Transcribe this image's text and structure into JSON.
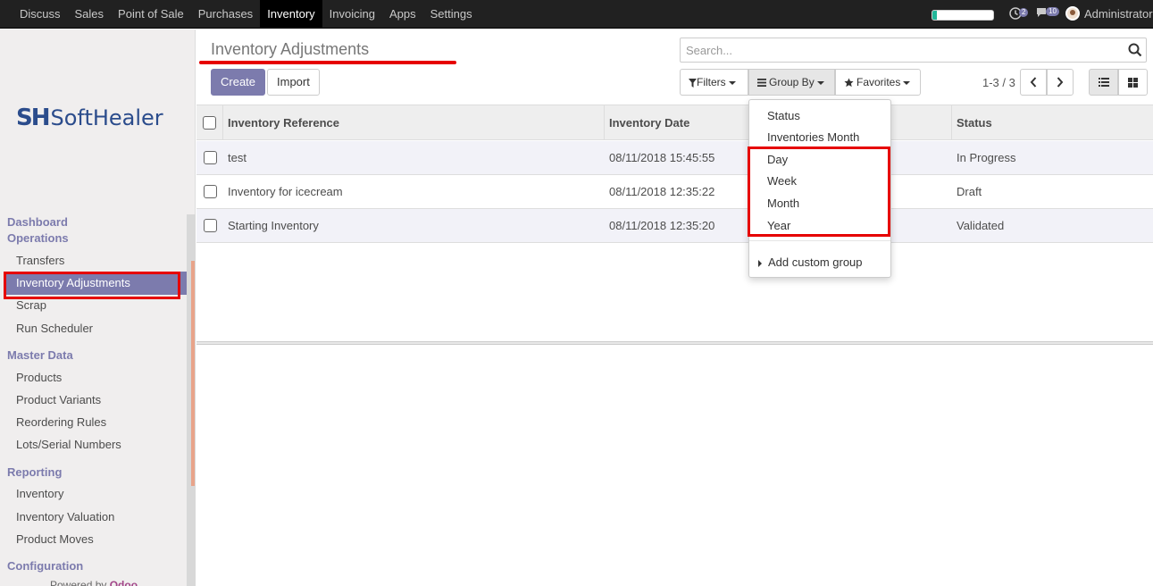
{
  "topbar": {
    "menu": [
      "Discuss",
      "Sales",
      "Point of Sale",
      "Purchases",
      "Inventory",
      "Invoicing",
      "Apps",
      "Settings"
    ],
    "active_menu": "Inventory",
    "progress_fraction": 0.07,
    "activity_badge": "2",
    "messages_badge": "10",
    "user": "Administrator"
  },
  "logo": {
    "mark": "SH",
    "word": "SoftHealer"
  },
  "sidebar": {
    "dashboard": "Dashboard",
    "operations": "Operations",
    "operations_items": [
      "Transfers",
      "Inventory Adjustments",
      "Scrap",
      "Run Scheduler"
    ],
    "master_data": "Master Data",
    "master_data_items": [
      "Products",
      "Product Variants",
      "Reordering Rules",
      "Lots/Serial Numbers"
    ],
    "reporting": "Reporting",
    "reporting_items": [
      "Inventory",
      "Inventory Valuation",
      "Product Moves"
    ],
    "configuration": "Configuration",
    "powered_prefix": "Powered by",
    "powered_brand": "Odoo"
  },
  "content": {
    "title": "Inventory Adjustments",
    "create_label": "Create",
    "import_label": "Import",
    "search_placeholder": "Search...",
    "filters_label": "Filters",
    "groupby_label": "Group By",
    "favorites_label": "Favorites",
    "pager": "1-3 / 3"
  },
  "table": {
    "columns": [
      "Inventory Reference",
      "Inventory Date",
      "Status"
    ],
    "rows": [
      {
        "reference": "test",
        "date": "08/11/2018 15:45:55",
        "status": "In Progress"
      },
      {
        "reference": "Inventory for icecream",
        "date": "08/11/2018 12:35:22",
        "status": "Draft"
      },
      {
        "reference": "Starting Inventory",
        "date": "08/11/2018 12:35:20",
        "status": "Validated"
      }
    ]
  },
  "groupby_menu": {
    "options": [
      "Status",
      "Inventories Month",
      "Day",
      "Week",
      "Month",
      "Year"
    ],
    "add_custom": "Add custom group"
  },
  "colors": {
    "accent": "#7c7bad",
    "highlight": "#e60000",
    "navbar": "#212121"
  }
}
